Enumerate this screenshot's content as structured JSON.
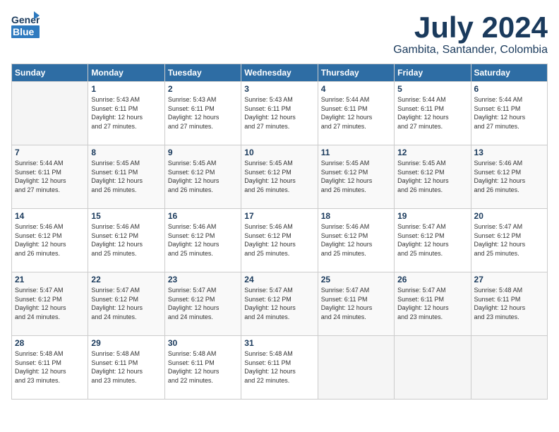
{
  "header": {
    "logo_line1": "General",
    "logo_line2": "Blue",
    "month_title": "July 2024",
    "subtitle": "Gambita, Santander, Colombia"
  },
  "weekdays": [
    "Sunday",
    "Monday",
    "Tuesday",
    "Wednesday",
    "Thursday",
    "Friday",
    "Saturday"
  ],
  "weeks": [
    [
      {
        "day": "",
        "info": ""
      },
      {
        "day": "1",
        "info": "Sunrise: 5:43 AM\nSunset: 6:11 PM\nDaylight: 12 hours\nand 27 minutes."
      },
      {
        "day": "2",
        "info": "Sunrise: 5:43 AM\nSunset: 6:11 PM\nDaylight: 12 hours\nand 27 minutes."
      },
      {
        "day": "3",
        "info": "Sunrise: 5:43 AM\nSunset: 6:11 PM\nDaylight: 12 hours\nand 27 minutes."
      },
      {
        "day": "4",
        "info": "Sunrise: 5:44 AM\nSunset: 6:11 PM\nDaylight: 12 hours\nand 27 minutes."
      },
      {
        "day": "5",
        "info": "Sunrise: 5:44 AM\nSunset: 6:11 PM\nDaylight: 12 hours\nand 27 minutes."
      },
      {
        "day": "6",
        "info": "Sunrise: 5:44 AM\nSunset: 6:11 PM\nDaylight: 12 hours\nand 27 minutes."
      }
    ],
    [
      {
        "day": "7",
        "info": "Sunrise: 5:44 AM\nSunset: 6:11 PM\nDaylight: 12 hours\nand 27 minutes."
      },
      {
        "day": "8",
        "info": "Sunrise: 5:45 AM\nSunset: 6:11 PM\nDaylight: 12 hours\nand 26 minutes."
      },
      {
        "day": "9",
        "info": "Sunrise: 5:45 AM\nSunset: 6:12 PM\nDaylight: 12 hours\nand 26 minutes."
      },
      {
        "day": "10",
        "info": "Sunrise: 5:45 AM\nSunset: 6:12 PM\nDaylight: 12 hours\nand 26 minutes."
      },
      {
        "day": "11",
        "info": "Sunrise: 5:45 AM\nSunset: 6:12 PM\nDaylight: 12 hours\nand 26 minutes."
      },
      {
        "day": "12",
        "info": "Sunrise: 5:45 AM\nSunset: 6:12 PM\nDaylight: 12 hours\nand 26 minutes."
      },
      {
        "day": "13",
        "info": "Sunrise: 5:46 AM\nSunset: 6:12 PM\nDaylight: 12 hours\nand 26 minutes."
      }
    ],
    [
      {
        "day": "14",
        "info": "Sunrise: 5:46 AM\nSunset: 6:12 PM\nDaylight: 12 hours\nand 26 minutes."
      },
      {
        "day": "15",
        "info": "Sunrise: 5:46 AM\nSunset: 6:12 PM\nDaylight: 12 hours\nand 25 minutes."
      },
      {
        "day": "16",
        "info": "Sunrise: 5:46 AM\nSunset: 6:12 PM\nDaylight: 12 hours\nand 25 minutes."
      },
      {
        "day": "17",
        "info": "Sunrise: 5:46 AM\nSunset: 6:12 PM\nDaylight: 12 hours\nand 25 minutes."
      },
      {
        "day": "18",
        "info": "Sunrise: 5:46 AM\nSunset: 6:12 PM\nDaylight: 12 hours\nand 25 minutes."
      },
      {
        "day": "19",
        "info": "Sunrise: 5:47 AM\nSunset: 6:12 PM\nDaylight: 12 hours\nand 25 minutes."
      },
      {
        "day": "20",
        "info": "Sunrise: 5:47 AM\nSunset: 6:12 PM\nDaylight: 12 hours\nand 25 minutes."
      }
    ],
    [
      {
        "day": "21",
        "info": "Sunrise: 5:47 AM\nSunset: 6:12 PM\nDaylight: 12 hours\nand 24 minutes."
      },
      {
        "day": "22",
        "info": "Sunrise: 5:47 AM\nSunset: 6:12 PM\nDaylight: 12 hours\nand 24 minutes."
      },
      {
        "day": "23",
        "info": "Sunrise: 5:47 AM\nSunset: 6:12 PM\nDaylight: 12 hours\nand 24 minutes."
      },
      {
        "day": "24",
        "info": "Sunrise: 5:47 AM\nSunset: 6:12 PM\nDaylight: 12 hours\nand 24 minutes."
      },
      {
        "day": "25",
        "info": "Sunrise: 5:47 AM\nSunset: 6:11 PM\nDaylight: 12 hours\nand 24 minutes."
      },
      {
        "day": "26",
        "info": "Sunrise: 5:47 AM\nSunset: 6:11 PM\nDaylight: 12 hours\nand 23 minutes."
      },
      {
        "day": "27",
        "info": "Sunrise: 5:48 AM\nSunset: 6:11 PM\nDaylight: 12 hours\nand 23 minutes."
      }
    ],
    [
      {
        "day": "28",
        "info": "Sunrise: 5:48 AM\nSunset: 6:11 PM\nDaylight: 12 hours\nand 23 minutes."
      },
      {
        "day": "29",
        "info": "Sunrise: 5:48 AM\nSunset: 6:11 PM\nDaylight: 12 hours\nand 23 minutes."
      },
      {
        "day": "30",
        "info": "Sunrise: 5:48 AM\nSunset: 6:11 PM\nDaylight: 12 hours\nand 22 minutes."
      },
      {
        "day": "31",
        "info": "Sunrise: 5:48 AM\nSunset: 6:11 PM\nDaylight: 12 hours\nand 22 minutes."
      },
      {
        "day": "",
        "info": ""
      },
      {
        "day": "",
        "info": ""
      },
      {
        "day": "",
        "info": ""
      }
    ]
  ]
}
